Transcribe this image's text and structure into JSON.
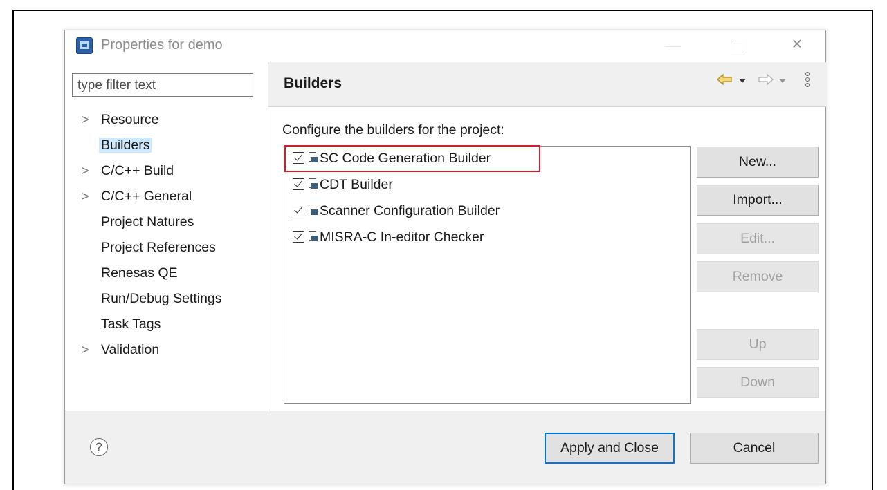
{
  "window": {
    "title": "Properties for demo"
  },
  "filter": {
    "placeholder": "type filter text"
  },
  "tree": [
    {
      "label": "Resource",
      "expandable": true,
      "selected": false
    },
    {
      "label": "Builders",
      "expandable": false,
      "selected": true
    },
    {
      "label": "C/C++ Build",
      "expandable": true,
      "selected": false
    },
    {
      "label": "C/C++ General",
      "expandable": true,
      "selected": false
    },
    {
      "label": "Project Natures",
      "expandable": false,
      "selected": false
    },
    {
      "label": "Project References",
      "expandable": false,
      "selected": false
    },
    {
      "label": "Renesas QE",
      "expandable": false,
      "selected": false
    },
    {
      "label": "Run/Debug Settings",
      "expandable": false,
      "selected": false
    },
    {
      "label": "Task Tags",
      "expandable": false,
      "selected": false
    },
    {
      "label": "Validation",
      "expandable": true,
      "selected": false
    }
  ],
  "page": {
    "title": "Builders",
    "description": "Configure the builders for the project:",
    "builders": [
      {
        "label": "SC Code Generation Builder",
        "checked": true,
        "highlighted": true
      },
      {
        "label": "CDT Builder",
        "checked": true
      },
      {
        "label": "Scanner Configuration Builder",
        "checked": true
      },
      {
        "label": "MISRA-C In-editor Checker",
        "checked": true
      }
    ],
    "buttons": {
      "new": "New...",
      "import": "Import...",
      "edit": "Edit...",
      "remove": "Remove",
      "up": "Up",
      "down": "Down"
    }
  },
  "footer": {
    "help_icon": "?",
    "apply_close": "Apply and Close",
    "cancel": "Cancel"
  },
  "colors": {
    "selection": "#cde8ff",
    "highlight_box": "#d01f2a",
    "default_button_border": "#0078d7"
  }
}
